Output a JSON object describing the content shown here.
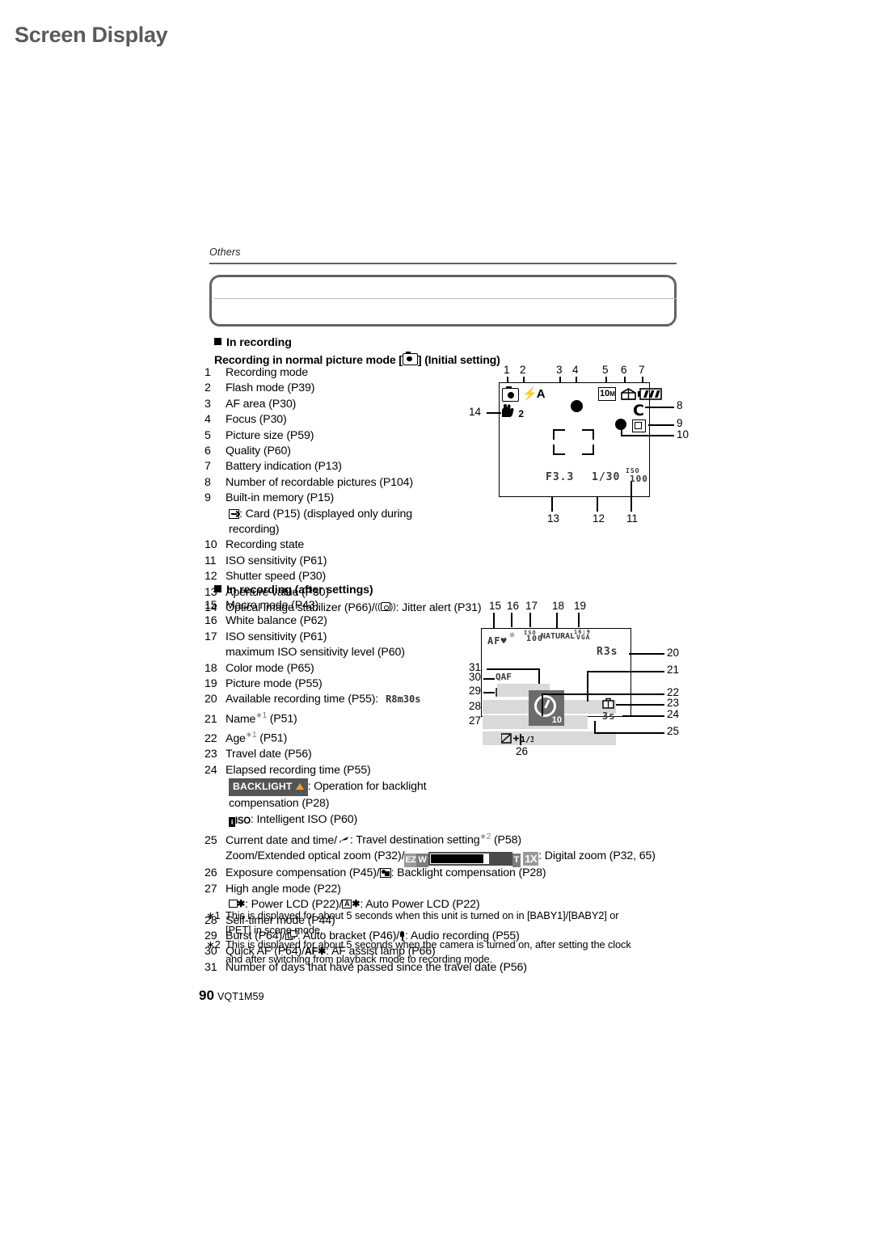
{
  "header": {
    "breadcrumb": "Others",
    "title": "Screen Display"
  },
  "sections": {
    "in_recording": "In recording",
    "in_recording_sub": "Recording in normal picture mode [■] (Initial setting)",
    "in_recording_sub_pre": "Recording in normal picture mode [",
    "in_recording_sub_post": "] (Initial setting)",
    "after_settings": "In recording (after settings)"
  },
  "list_first": [
    {
      "num": "1",
      "text": "Recording mode"
    },
    {
      "num": "2",
      "text": "Flash mode (P39)"
    },
    {
      "num": "3",
      "text": "AF area (P30)"
    },
    {
      "num": "4",
      "text": "Focus (P30)"
    },
    {
      "num": "5",
      "text": "Picture size (P59)"
    },
    {
      "num": "6",
      "text": "Quality (P60)"
    },
    {
      "num": "7",
      "text": "Battery indication (P13)"
    },
    {
      "num": "8",
      "text": "Number of recordable pictures (P104)"
    },
    {
      "num": "9",
      "text": "Built-in memory (P15)"
    },
    {
      "num": "10",
      "text": "Recording state"
    },
    {
      "num": "11",
      "text": "ISO sensitivity (P61)"
    },
    {
      "num": "12",
      "text": "Shutter speed (P30)"
    },
    {
      "num": "13",
      "text": "Aperture value (P30)"
    },
    {
      "num": "14",
      "text": "Optical image stabilizer (P66)/"
    }
  ],
  "item9_sub": ": Card (P15) (displayed only during",
  "item9_sub2": "recording)",
  "item14_tail": ": Jitter alert (P31)",
  "list_second": [
    {
      "num": "15",
      "text": "Macro mode (P43)"
    },
    {
      "num": "16",
      "text": "White balance (P62)"
    },
    {
      "num": "17",
      "text": "ISO sensitivity (P61)"
    },
    {
      "num": "18",
      "text": "Color mode (P65)"
    },
    {
      "num": "19",
      "text": "Picture mode (P55)"
    },
    {
      "num": "20",
      "text": "Available recording time (P55):"
    },
    {
      "num": "21",
      "text": "Name"
    },
    {
      "num": "22",
      "text": "Age"
    },
    {
      "num": "23",
      "text": "Travel date (P56)"
    },
    {
      "num": "24",
      "text": "Elapsed recording time (P55)"
    },
    {
      "num": "25",
      "text": "Current date and time/"
    },
    {
      "num": "26",
      "text": "Exposure compensation (P45)/"
    },
    {
      "num": "27",
      "text": "High angle mode (P22)"
    },
    {
      "num": "28",
      "text": "Self-timer mode (P44)"
    },
    {
      "num": "29",
      "text": "Burst (P64)/"
    },
    {
      "num": "30",
      "text": "Quick AF (P64)/"
    },
    {
      "num": "31",
      "text": "Number of days that have passed since the travel date (P56)"
    }
  ],
  "item17_sub": "maximum ISO sensitivity level (P60)",
  "item20_value": "R8m30s",
  "item21_sup": "∗1",
  "item21_tail": "(P51)",
  "item22_sup": "∗1",
  "item22_tail": "(P51)",
  "item24_backlight_label": "BACKLIGHT",
  "item24_backlight_tail": ": Operation for backlight",
  "item24_backlight_tail2": "compensation (P28)",
  "item24_iiso_label": "ISO",
  "item24_iiso_tail": ": Intelligent ISO (P60)",
  "item25_tail": ": Travel destination setting",
  "item25_sup": "∗2",
  "item25_page": "(P58)",
  "item25_line2_pre": "Zoom/Extended optical zoom (P32)/",
  "item25_line2_post": ": Digital zoom (P32, 65)",
  "zoombar": {
    "ez": "EZ",
    "w": "W",
    "t": "T",
    "digital": "1X"
  },
  "item26_tail": ": Backlight compensation (P28)",
  "item27_sub_pre": ": Power LCD (P22)/",
  "item27_sub_post": ": Auto Power LCD (P22)",
  "item27_auto_letter": "A",
  "item29_mid": ": Auto bracket (P46)/",
  "item29_tail": ": Audio recording (P55)",
  "item30_af": "AF✱",
  "item30_tail": ": AF assist lamp (P66)",
  "footnotes": [
    {
      "mark": "∗1",
      "line1": "This is displayed for about 5 seconds when this unit is turned on in [BABY1]/[BABY2] or",
      "line2": "[PET] in scene mode."
    },
    {
      "mark": "∗2",
      "line1": "This is displayed for about 5 seconds when the camera is turned on, after setting the clock",
      "line2": "and after switching from playback mode to recording mode."
    }
  ],
  "footer": {
    "page_number": "90",
    "doc_code": "VQT1M59"
  },
  "diagram1": {
    "callouts_top": [
      "1",
      "2",
      "3",
      "4",
      "5",
      "6",
      "7"
    ],
    "callouts_right": [
      "8",
      "9",
      "10"
    ],
    "callout_left": "14",
    "callouts_bottom": [
      "13",
      "12",
      "11"
    ],
    "osd": {
      "flash": "A",
      "picture_size": "10",
      "picture_size_unit": "M",
      "ois_number": "2",
      "aperture": "F3.3",
      "shutter": "1/30",
      "iso_label": "ISO",
      "iso_value": "100",
      "memory_letter": "C"
    }
  },
  "diagram2": {
    "callouts_top": [
      "15",
      "16",
      "17",
      "18",
      "19"
    ],
    "callouts_right": [
      "20",
      "21",
      "22",
      "23",
      "24",
      "25"
    ],
    "callouts_left": [
      "31",
      "30",
      "29",
      "28",
      "27"
    ],
    "callout_bottom": "26",
    "osd": {
      "macro": "AF",
      "iso_label": "ISO",
      "iso_value": "100",
      "color_mode": "NATURAL",
      "picture_mode_top": "16:9",
      "picture_mode_bottom": "VGA",
      "rec_time": "R3s",
      "quick_af": "AF",
      "elapsed": "3s",
      "self_timer_sec": "10"
    }
  },
  "colors": {
    "accent_title": "#5a5a5a",
    "box_border": "#636363",
    "osd_bar": "#d9d9d9",
    "selftimer_bg": "#6b6b6b",
    "backlight_tag": "#555555",
    "backlight_triangle": "#f0a030"
  }
}
